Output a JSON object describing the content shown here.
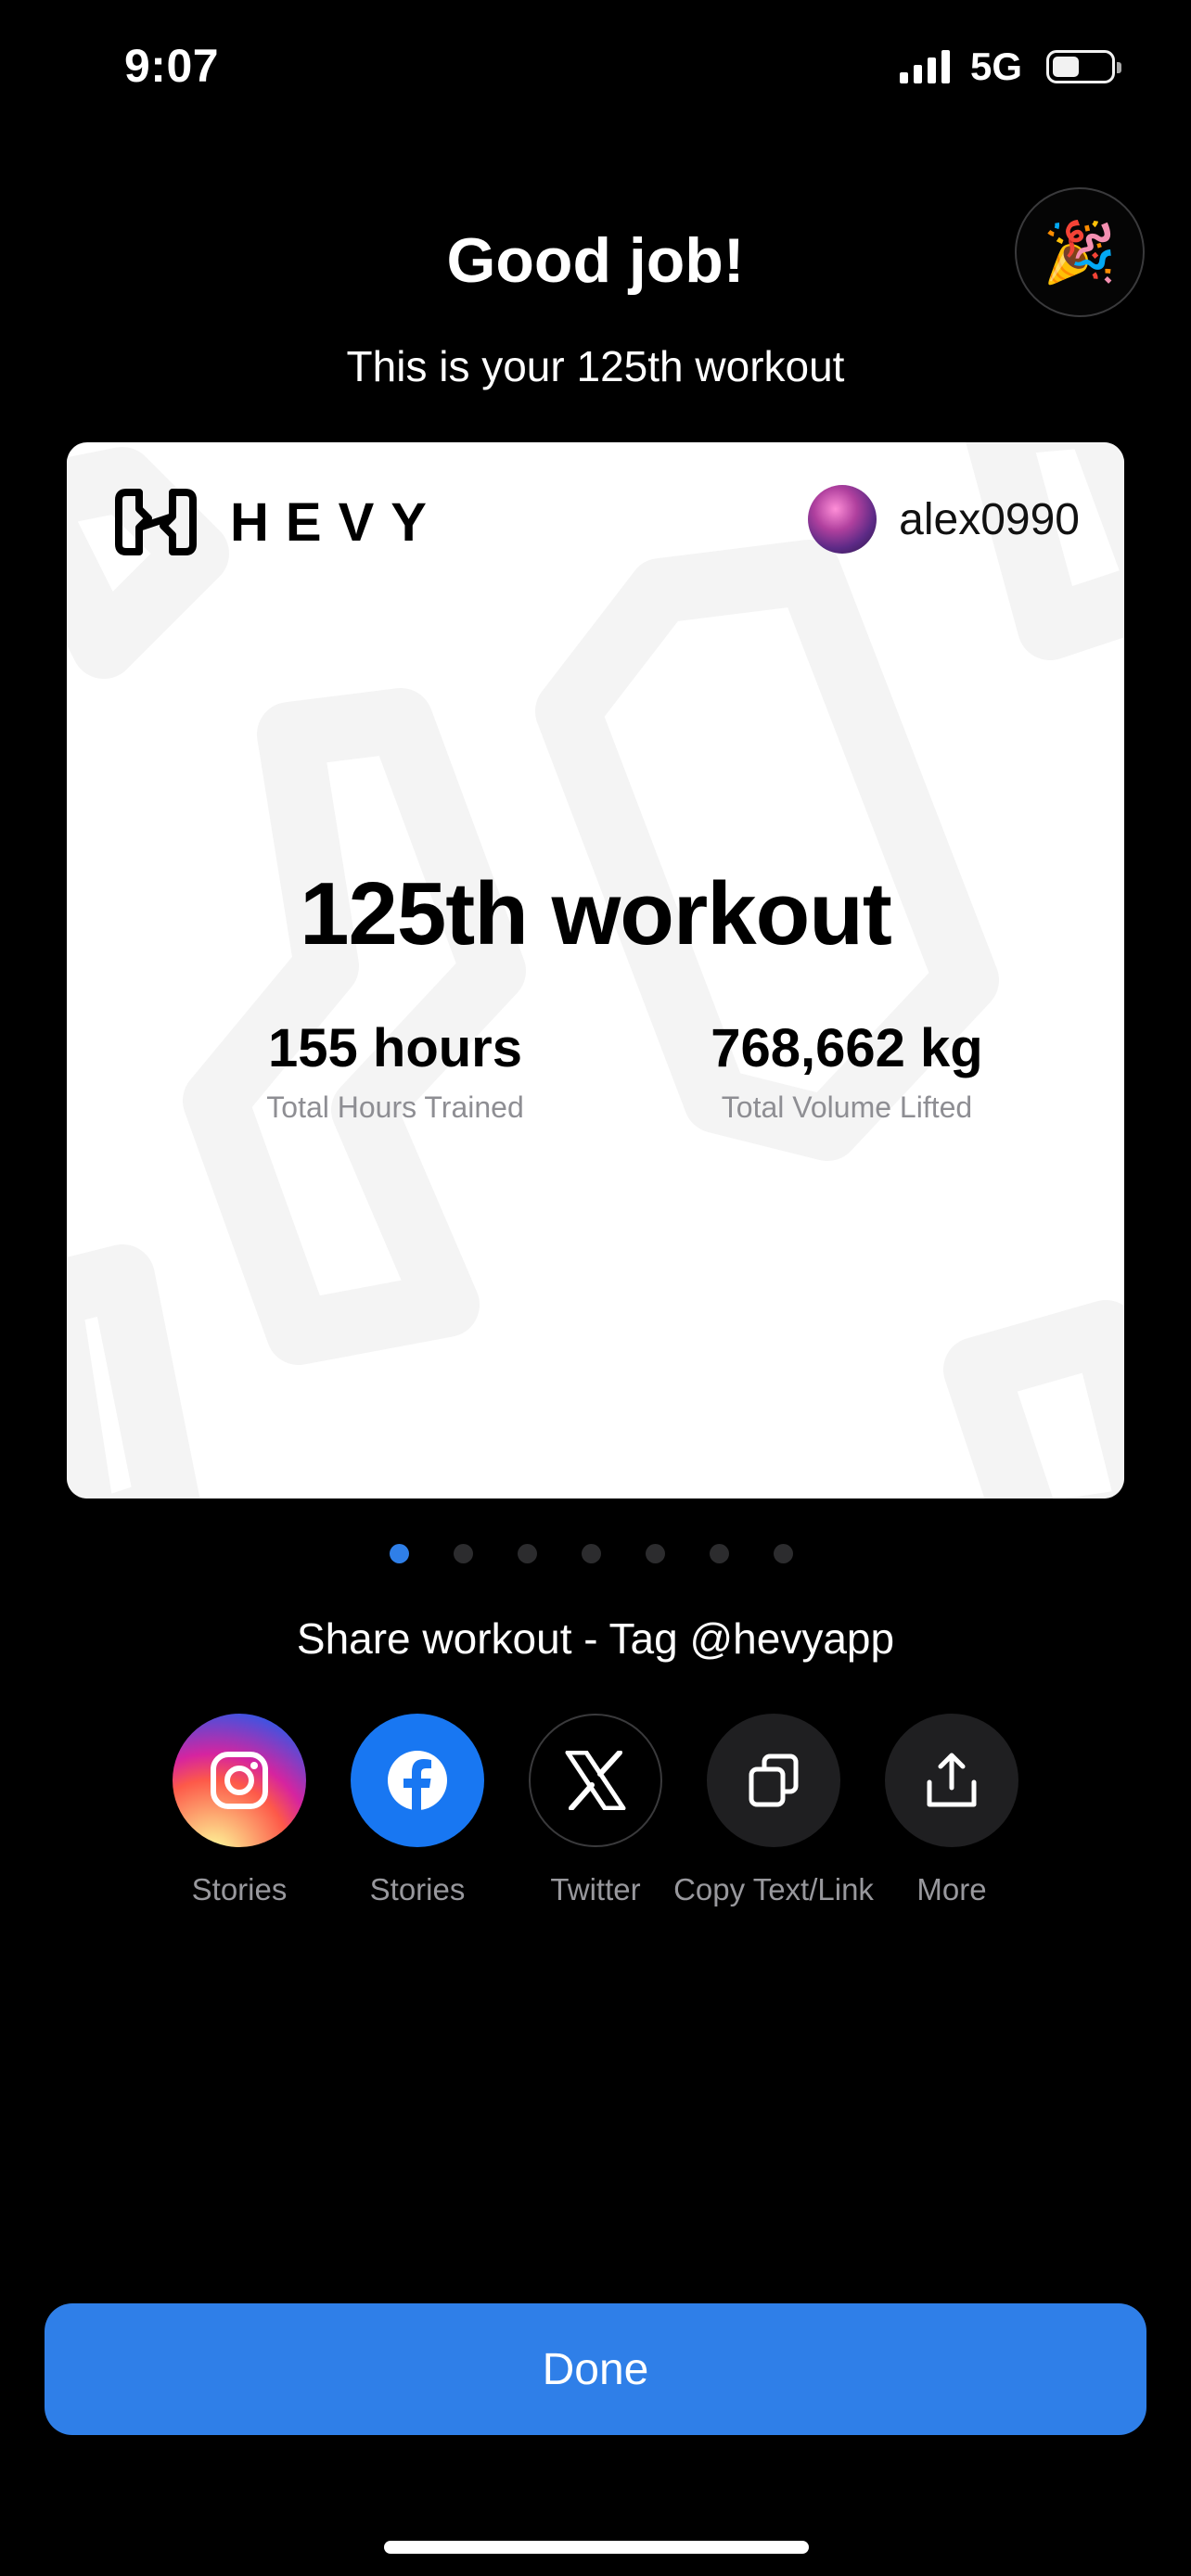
{
  "status_bar": {
    "time": "9:07",
    "network": "5G",
    "battery_level": 0.45
  },
  "header": {
    "title": "Good job!",
    "subtitle": "This is your 125th workout",
    "party_icon": "🎉"
  },
  "card": {
    "brand": "HEVY",
    "username": "alex0990",
    "title": "125th workout",
    "stats": [
      {
        "value": "155 hours",
        "label": "Total Hours Trained"
      },
      {
        "value": "768,662 kg",
        "label": "Total Volume Lifted"
      }
    ]
  },
  "pager": {
    "count": 7,
    "active_index": 0
  },
  "share": {
    "title": "Share workout - Tag @hevyapp",
    "options": [
      {
        "label": "Stories",
        "icon": "instagram-icon"
      },
      {
        "label": "Stories",
        "icon": "facebook-icon"
      },
      {
        "label": "Twitter",
        "icon": "x-icon"
      },
      {
        "label": "Copy Text/Link",
        "icon": "copy-icon"
      },
      {
        "label": "More",
        "icon": "share-icon"
      }
    ]
  },
  "done_label": "Done",
  "colors": {
    "accent": "#2f7fe8",
    "background": "#000000",
    "card": "#ffffff"
  }
}
